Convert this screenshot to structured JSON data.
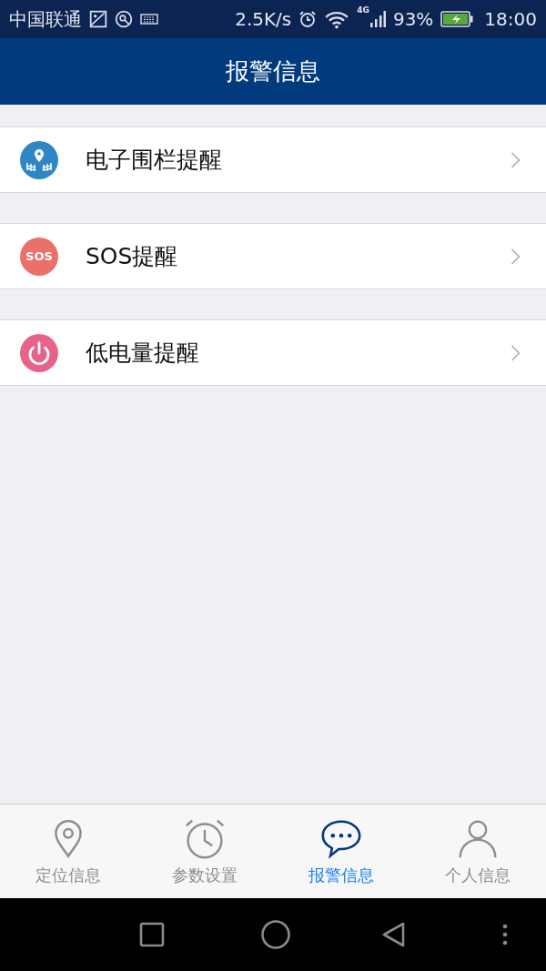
{
  "status_bar": {
    "carrier": "中国联通",
    "speed": "2.5K/s",
    "network": "4G",
    "battery": "93%",
    "time": "18:00"
  },
  "header": {
    "title": "报警信息"
  },
  "items": [
    {
      "kind": "fence",
      "label": "电子围栏提醒"
    },
    {
      "kind": "sos",
      "label": "SOS提醒",
      "icon_text": "SOS"
    },
    {
      "kind": "power",
      "label": "低电量提醒"
    }
  ],
  "tabs": [
    {
      "kind": "pin",
      "label": "定位信息",
      "selected": false
    },
    {
      "kind": "alarm",
      "label": "参数设置",
      "selected": false
    },
    {
      "kind": "chat",
      "label": "报警信息",
      "selected": true
    },
    {
      "kind": "person",
      "label": "个人信息",
      "selected": false
    }
  ]
}
